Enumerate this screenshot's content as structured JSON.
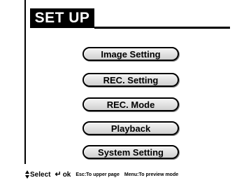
{
  "header": {
    "title": "SET UP"
  },
  "menu": {
    "items": [
      {
        "label": "Image Setting"
      },
      {
        "label": "REC. Setting"
      },
      {
        "label": "REC. Mode"
      },
      {
        "label": "Playback"
      },
      {
        "label": "System Setting"
      }
    ]
  },
  "footer": {
    "select_label": "Select",
    "ok_label": "ok",
    "esc_hint": "Esc:To upper page",
    "menu_hint": "Menu:To preview mode",
    "icons": {
      "updown": "up-down-arrows-icon",
      "enter": "enter-icon"
    }
  }
}
